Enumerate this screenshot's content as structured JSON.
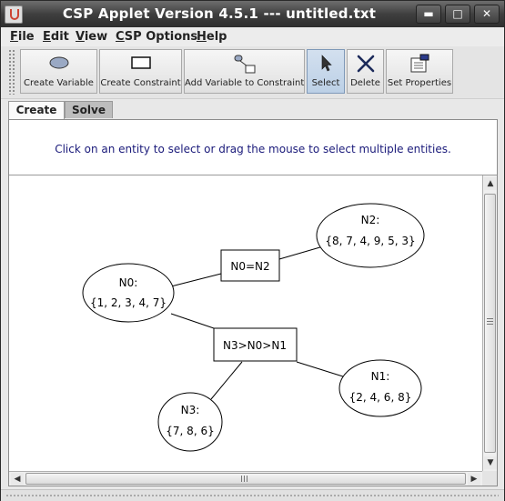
{
  "window": {
    "title": "CSP Applet Version 4.5.1 --- untitled.txt"
  },
  "menubar": {
    "items": [
      {
        "key": "F",
        "rest": "ile"
      },
      {
        "key": "E",
        "rest": "dit"
      },
      {
        "key": "V",
        "rest": "iew"
      },
      {
        "key": "C",
        "rest": "SP Options"
      },
      {
        "key": "H",
        "rest": "elp"
      }
    ]
  },
  "toolbar": {
    "create_variable": "Create Variable",
    "create_constraint": "Create Constraint",
    "add_variable_to_constraint": "Add Variable to Constraint",
    "select": "Select",
    "delete": "Delete",
    "set_properties": "Set Properties",
    "selected": "Select"
  },
  "tabs": {
    "create": "Create",
    "solve": "Solve",
    "active": "Create"
  },
  "instruction": "Click on an entity to select or drag the mouse to select multiple entities.",
  "graph": {
    "variables": [
      {
        "id": "N0",
        "name": "N0:",
        "domain": "{1, 2, 3, 4, 7}"
      },
      {
        "id": "N1",
        "name": "N1:",
        "domain": "{2, 4, 6, 8}"
      },
      {
        "id": "N2",
        "name": "N2:",
        "domain": "{8, 7, 4, 9, 5, 3}"
      },
      {
        "id": "N3",
        "name": "N3:",
        "domain": "{7, 8, 6}"
      }
    ],
    "constraints": [
      {
        "id": "c1",
        "label": "N0=N2",
        "vars": [
          "N0",
          "N2"
        ]
      },
      {
        "id": "c2",
        "label": "N3>N0>N1",
        "vars": [
          "N0",
          "N3",
          "N1"
        ]
      }
    ]
  },
  "colors": {
    "instruction_text": "#1a1a7a",
    "select_tool_bg": "#c6d6ea",
    "title_bar": "#3f3f3f"
  }
}
